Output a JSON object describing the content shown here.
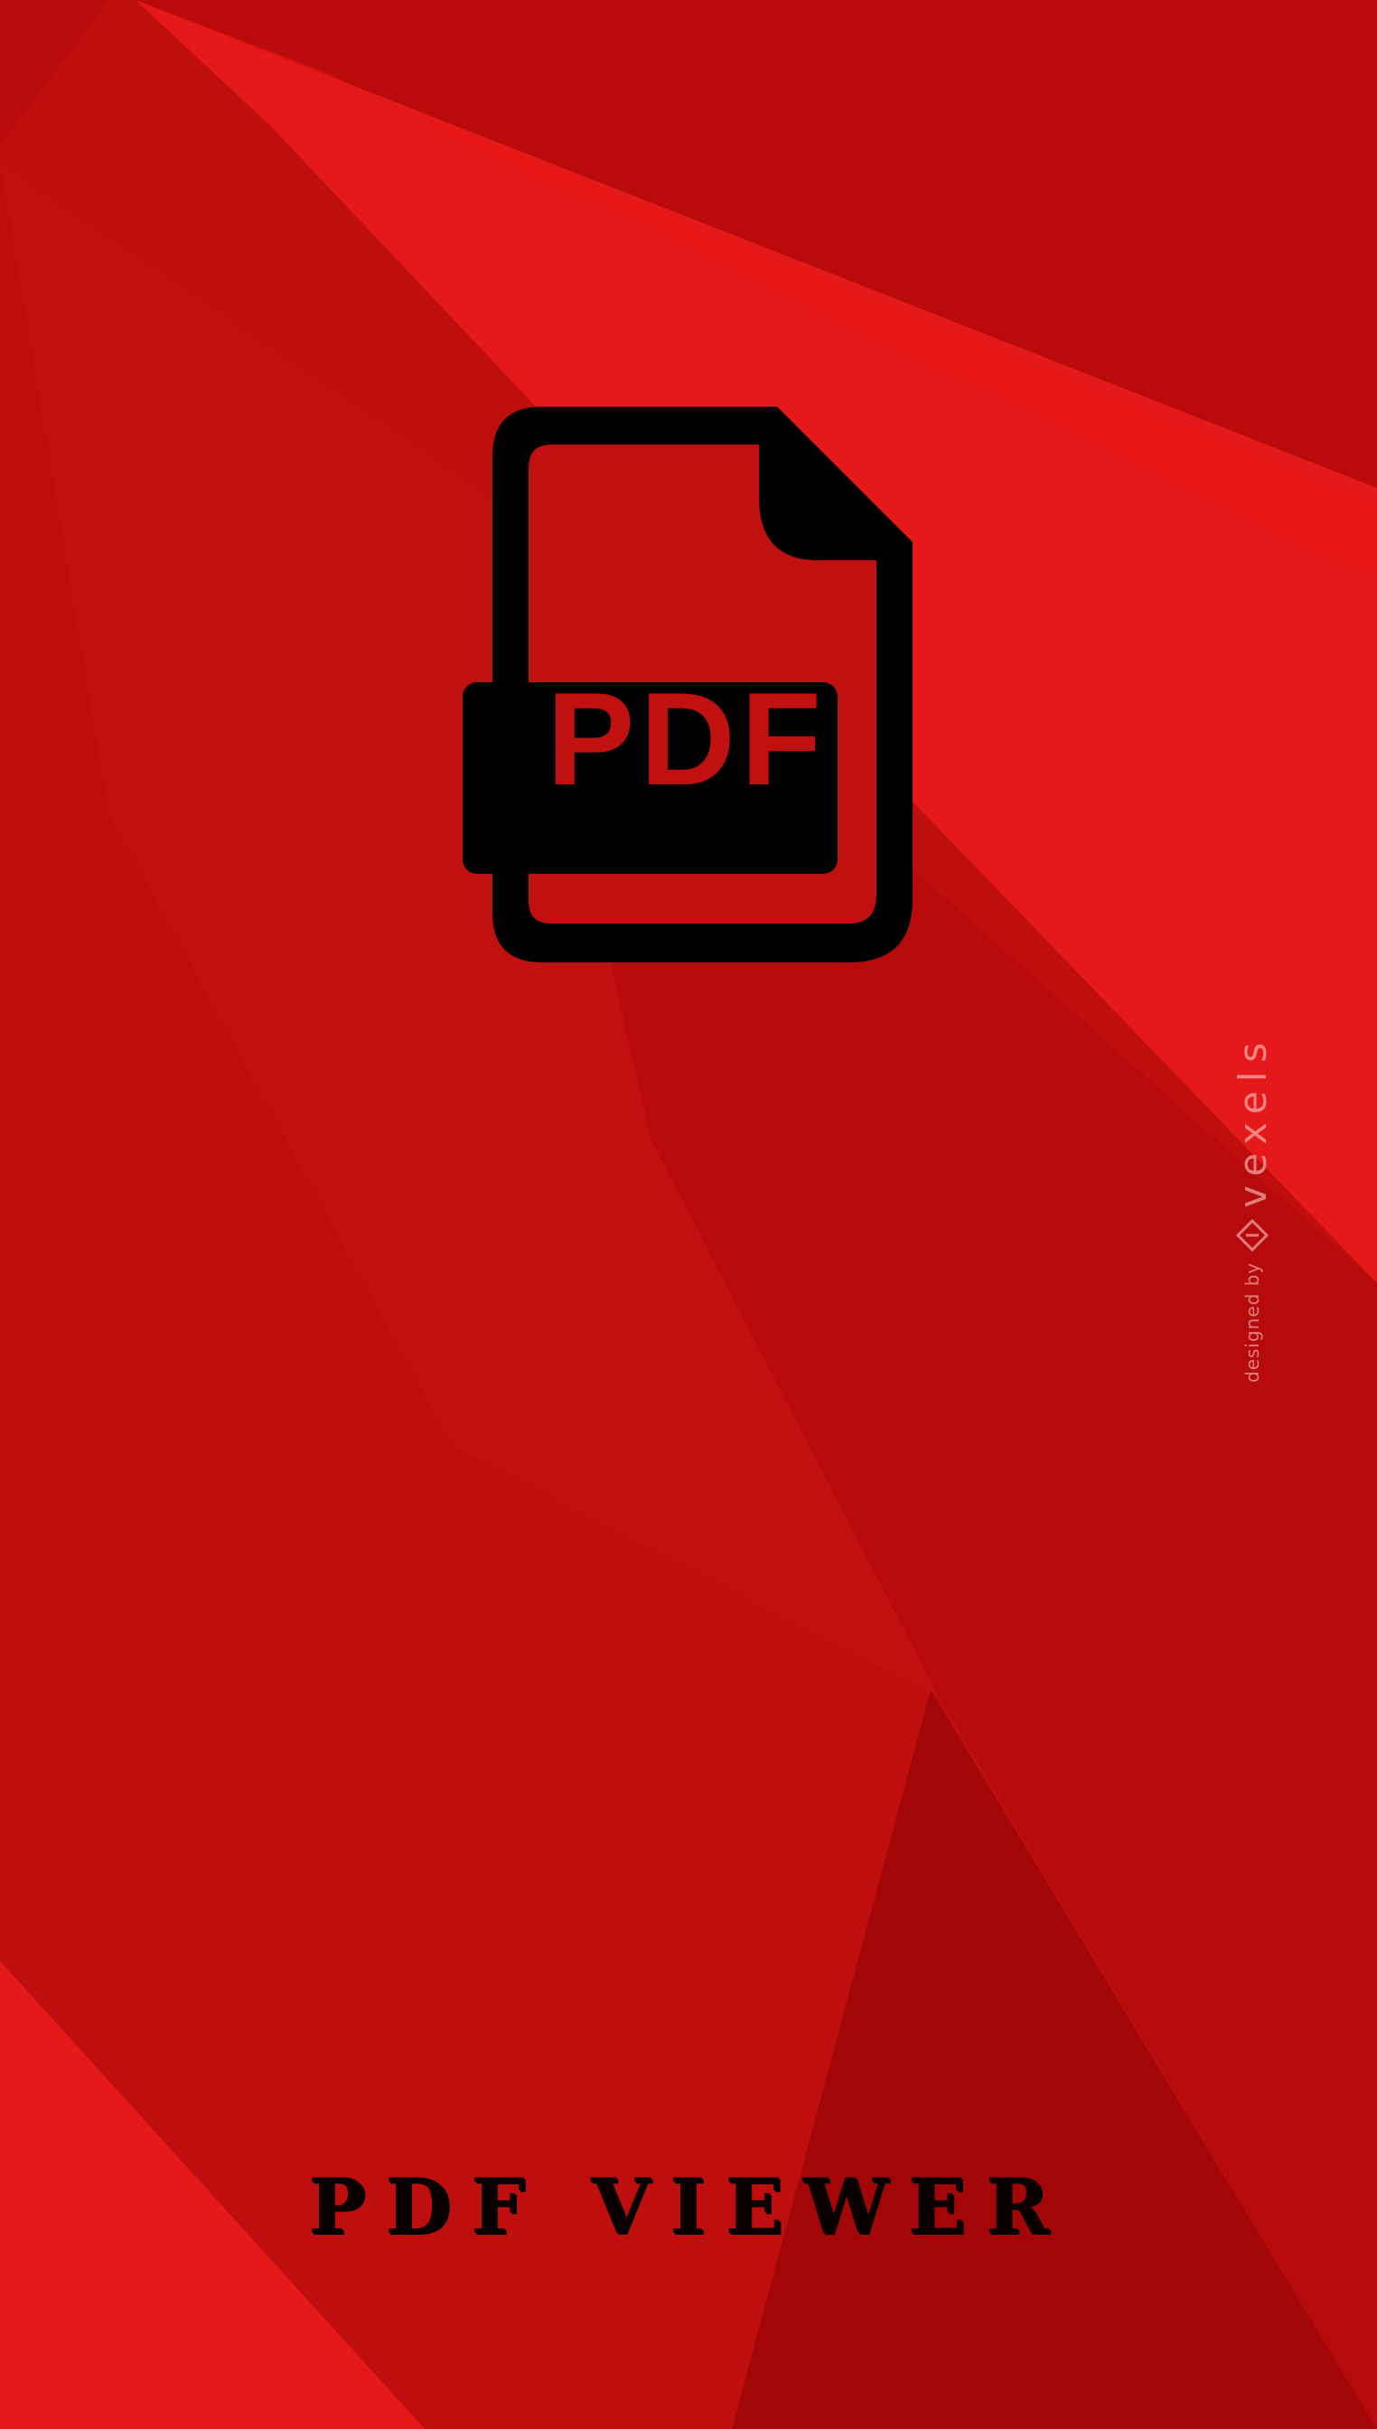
{
  "splash": {
    "app_title": "PDF VIEWER",
    "icon_label": "PDF",
    "icon_name": "pdf-file-icon",
    "watermark": {
      "prefix": "designed by",
      "brand": "vexels",
      "logo_name": "vexels-logo-icon"
    }
  },
  "colors": {
    "background_base": "#bf0e0e",
    "background_light": "#e51919",
    "background_dark": "#a30606",
    "icon": "#000000",
    "title_text": "#0a0000"
  }
}
